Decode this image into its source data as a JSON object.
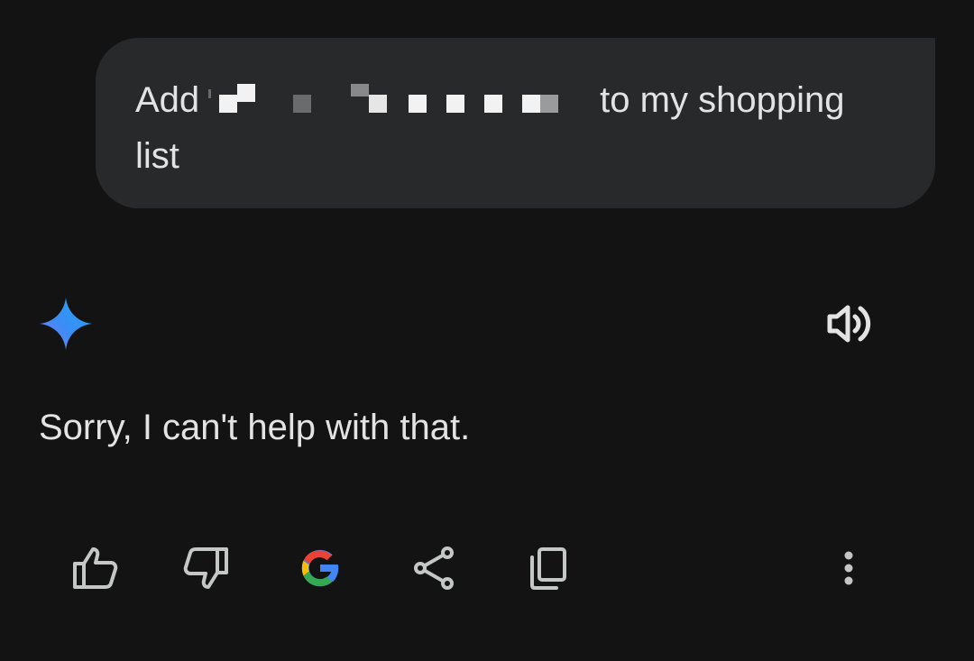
{
  "user_message": {
    "text_before": "Add",
    "text_after": "to my shopping list",
    "redacted": true
  },
  "assistant": {
    "reply": "Sorry, I can't help with that.",
    "avatar_icon": "gemini-sparkle-icon",
    "read_aloud_icon": "speaker-icon"
  },
  "actions": [
    {
      "name": "thumbs-up",
      "icon": "thumbs-up-icon"
    },
    {
      "name": "thumbs-down",
      "icon": "thumbs-down-icon"
    },
    {
      "name": "google-search",
      "icon": "google-g-icon"
    },
    {
      "name": "share",
      "icon": "share-icon"
    },
    {
      "name": "copy",
      "icon": "copy-icon"
    },
    {
      "name": "more",
      "icon": "more-vert-icon"
    }
  ],
  "colors": {
    "background": "#131314",
    "bubble": "#28292b",
    "text": "#e3e3e3",
    "icon": "#c4c7c5"
  }
}
